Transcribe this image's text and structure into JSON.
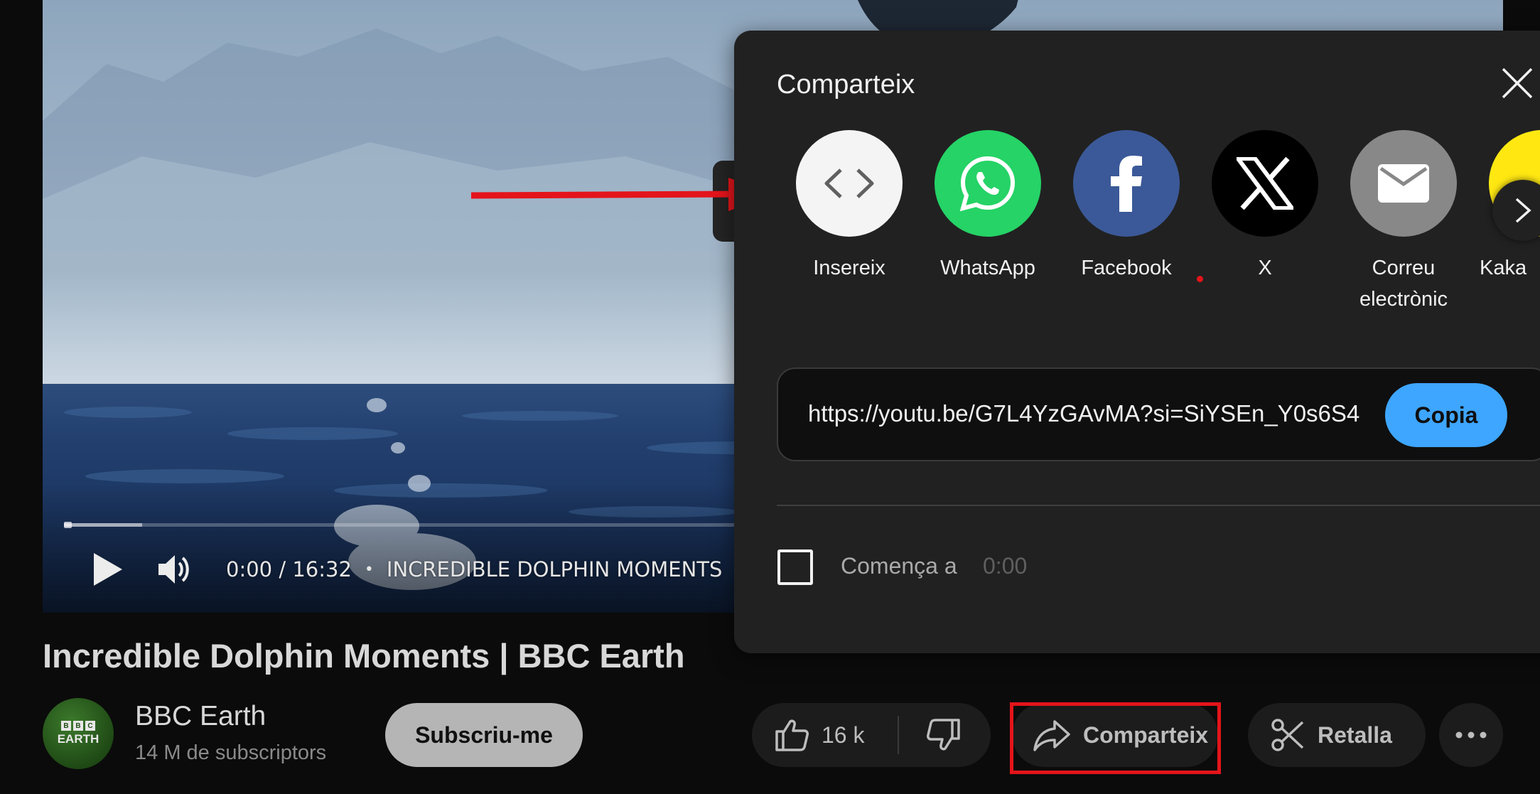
{
  "player": {
    "time": "0:00 / 16:32",
    "bullet": "•",
    "chapter": "INCREDIBLE DOLPHIN MOMENTS",
    "progress_fraction": 0
  },
  "share_dialog": {
    "title": "Comparteix",
    "options": [
      {
        "label": "Insereix",
        "icon": "embed-icon",
        "color": "#f1f1f1"
      },
      {
        "label": "WhatsApp",
        "icon": "whatsapp-icon",
        "color": "#25d366"
      },
      {
        "label": "Facebook",
        "icon": "facebook-icon",
        "color": "#3b5998"
      },
      {
        "label": "X",
        "icon": "x-icon",
        "color": "#000000"
      },
      {
        "label": "Correu electrònic",
        "icon": "email-icon",
        "color": "#888888"
      },
      {
        "label": "Kaka",
        "icon": "kakaotalk-icon",
        "color": "#ffe812"
      }
    ],
    "url": "https://youtu.be/G7L4YzGAvMA?si=SiYSEn_Y0s6S4",
    "copy_label": "Copia",
    "start_label": "Comença a",
    "start_time": "0:00"
  },
  "video": {
    "title": "Incredible Dolphin Moments | BBC Earth"
  },
  "channel": {
    "name": "BBC Earth",
    "subscribers": "14 M de subscriptors",
    "avatar_boxes": [
      "B",
      "B",
      "C"
    ],
    "avatar_text": "EARTH",
    "subscribe_label": "Subscriu-me"
  },
  "actions": {
    "like_count": "16 k",
    "share_label": "Comparteix",
    "clip_label": "Retalla"
  },
  "colors": {
    "accent": "#3ea6ff",
    "annotation": "#e4141b",
    "dialog_bg": "#212121"
  }
}
